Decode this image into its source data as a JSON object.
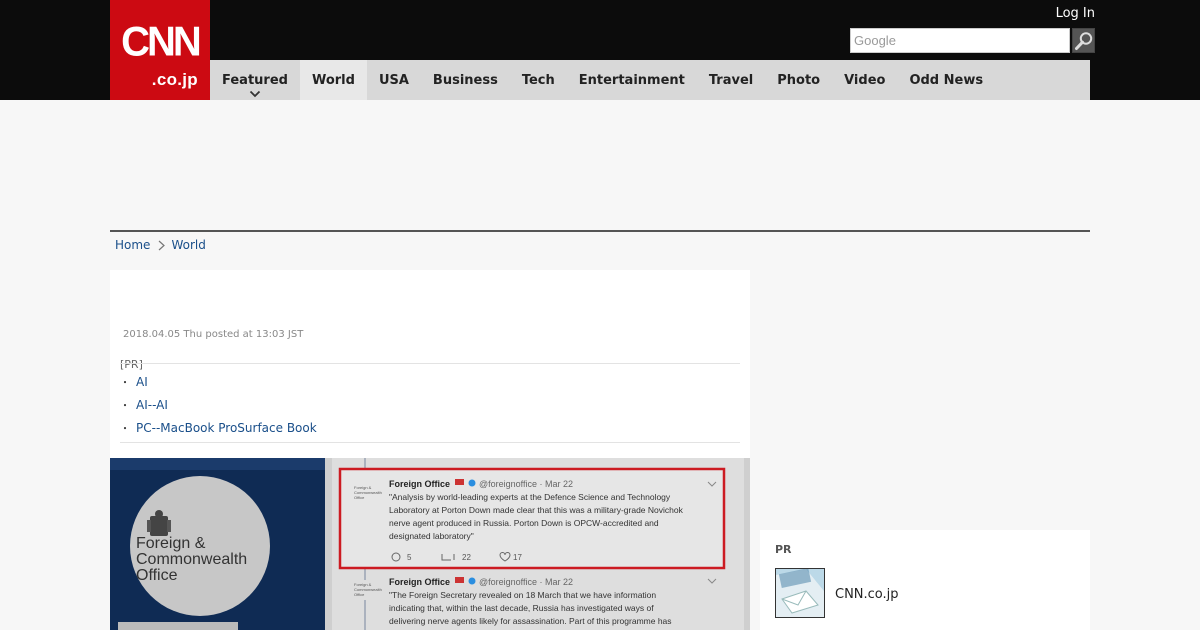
{
  "header": {
    "logo_main": "CNN",
    "logo_sub": ".co.jp",
    "login_label": "Log In",
    "search_placeholder": "Google"
  },
  "nav": {
    "items": [
      {
        "label": "Featured"
      },
      {
        "label": "World"
      },
      {
        "label": "USA"
      },
      {
        "label": "Business"
      },
      {
        "label": "Tech"
      },
      {
        "label": "Entertainment"
      },
      {
        "label": "Travel"
      },
      {
        "label": "Photo"
      },
      {
        "label": "Video"
      },
      {
        "label": "Odd News"
      }
    ]
  },
  "breadcrumb": {
    "home": "Home",
    "current": "World"
  },
  "article": {
    "post_date": "2018.04.05 Thu posted at 13:03 JST",
    "pr_label": "[PR]",
    "pr_links": [
      "AI",
      "AI--AI",
      "PC--MacBook ProSurface Book"
    ],
    "bullet": "・"
  },
  "photo": {
    "org_name_line1": "Foreign &",
    "org_name_line2": "Commonwealth",
    "org_name_line3": "Office",
    "tweets": [
      {
        "account": "Foreign Office",
        "handle": "@foreignoffice · Mar 22",
        "text_lines": [
          "\"Analysis by world-leading experts at the Defence Science and Technology",
          "Laboratory at Porton Down made clear that this was a military-grade Novichok",
          "nerve agent produced in Russia. Porton Down is OPCW-accredited and",
          "designated laboratory\""
        ],
        "replies": "5",
        "retweets": "22",
        "likes": "17"
      },
      {
        "account": "Foreign Office",
        "handle": "@foreignoffice · Mar 22",
        "text_lines": [
          "\"The Foreign Secretary revealed on 18 March that we have information",
          "indicating that, within the last decade, Russia has investigated ways of",
          "delivering nerve agents likely for assassination. Part of this programme has"
        ]
      }
    ]
  },
  "sidebar": {
    "pr_label": "PR",
    "item_text": "CNN.co.jp"
  },
  "colors": {
    "brand_red": "#cc0a12",
    "top_bar": "#0c0c0c",
    "nav_bg": "#d8d8d8",
    "link_blue": "#1a4f8a"
  }
}
